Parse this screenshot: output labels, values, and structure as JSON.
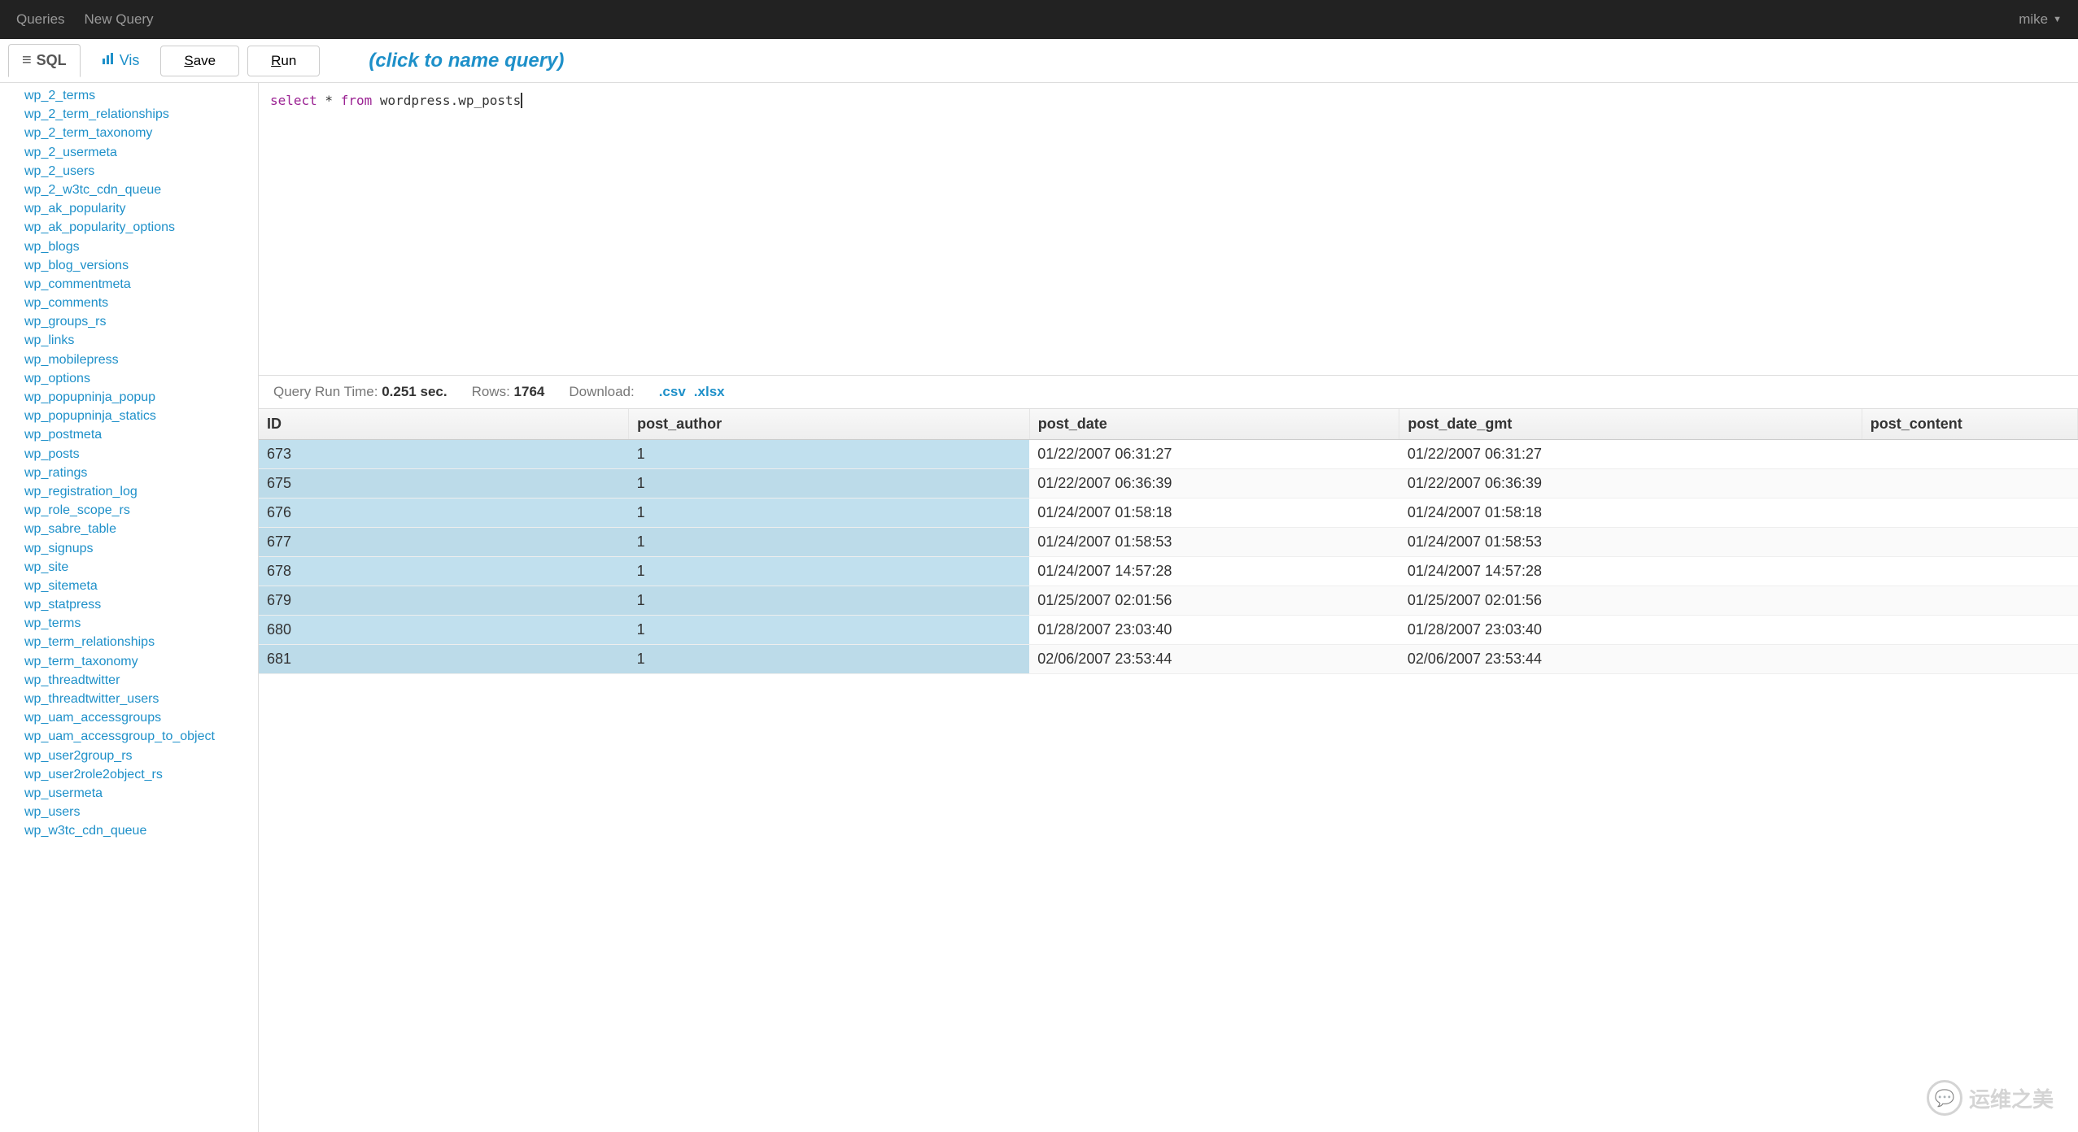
{
  "nav": {
    "queries": "Queries",
    "new_query": "New Query",
    "user": "mike"
  },
  "toolbar": {
    "tab_sql": "SQL",
    "tab_vis": "Vis",
    "save": "Save",
    "run": "Run"
  },
  "query_name_placeholder": "(click to name query)",
  "editor": {
    "kw_select": "select",
    "star": " * ",
    "kw_from": "from",
    "rest": " wordpress.wp_posts"
  },
  "status": {
    "runtime_label": "Query Run Time: ",
    "runtime_value": "0.251 sec.",
    "rows_label": "Rows: ",
    "rows_value": "1764",
    "download_label": "Download:",
    "csv": ".csv",
    "xlsx": ".xlsx"
  },
  "sidebar": [
    "wp_2_terms",
    "wp_2_term_relationships",
    "wp_2_term_taxonomy",
    "wp_2_usermeta",
    "wp_2_users",
    "wp_2_w3tc_cdn_queue",
    "wp_ak_popularity",
    "wp_ak_popularity_options",
    "wp_blogs",
    "wp_blog_versions",
    "wp_commentmeta",
    "wp_comments",
    "wp_groups_rs",
    "wp_links",
    "wp_mobilepress",
    "wp_options",
    "wp_popupninja_popup",
    "wp_popupninja_statics",
    "wp_postmeta",
    "wp_posts",
    "wp_ratings",
    "wp_registration_log",
    "wp_role_scope_rs",
    "wp_sabre_table",
    "wp_signups",
    "wp_site",
    "wp_sitemeta",
    "wp_statpress",
    "wp_terms",
    "wp_term_relationships",
    "wp_term_taxonomy",
    "wp_threadtwitter",
    "wp_threadtwitter_users",
    "wp_uam_accessgroups",
    "wp_uam_accessgroup_to_object",
    "wp_user2group_rs",
    "wp_user2role2object_rs",
    "wp_usermeta",
    "wp_users",
    "wp_w3tc_cdn_queue"
  ],
  "columns": [
    "ID",
    "post_author",
    "post_date",
    "post_date_gmt",
    "post_content"
  ],
  "col_widths": [
    "240px",
    "260px",
    "240px",
    "300px",
    "140px"
  ],
  "rows": [
    {
      "id": "673",
      "author": "1",
      "date": "01/22/2007 06:31:27",
      "gmt": "01/22/2007 06:31:27",
      "content": ""
    },
    {
      "id": "675",
      "author": "1",
      "date": "01/22/2007 06:36:39",
      "gmt": "01/22/2007 06:36:39",
      "content": ""
    },
    {
      "id": "676",
      "author": "1",
      "date": "01/24/2007 01:58:18",
      "gmt": "01/24/2007 01:58:18",
      "content": ""
    },
    {
      "id": "677",
      "author": "1",
      "date": "01/24/2007 01:58:53",
      "gmt": "01/24/2007 01:58:53",
      "content": ""
    },
    {
      "id": "678",
      "author": "1",
      "date": "01/24/2007 14:57:28",
      "gmt": "01/24/2007 14:57:28",
      "content": ""
    },
    {
      "id": "679",
      "author": "1",
      "date": "01/25/2007 02:01:56",
      "gmt": "01/25/2007 02:01:56",
      "content": ""
    },
    {
      "id": "680",
      "author": "1",
      "date": "01/28/2007 23:03:40",
      "gmt": "01/28/2007 23:03:40",
      "content": ""
    },
    {
      "id": "681",
      "author": "1",
      "date": "02/06/2007 23:53:44",
      "gmt": "02/06/2007 23:53:44",
      "content": ""
    }
  ],
  "watermark": "运维之美"
}
